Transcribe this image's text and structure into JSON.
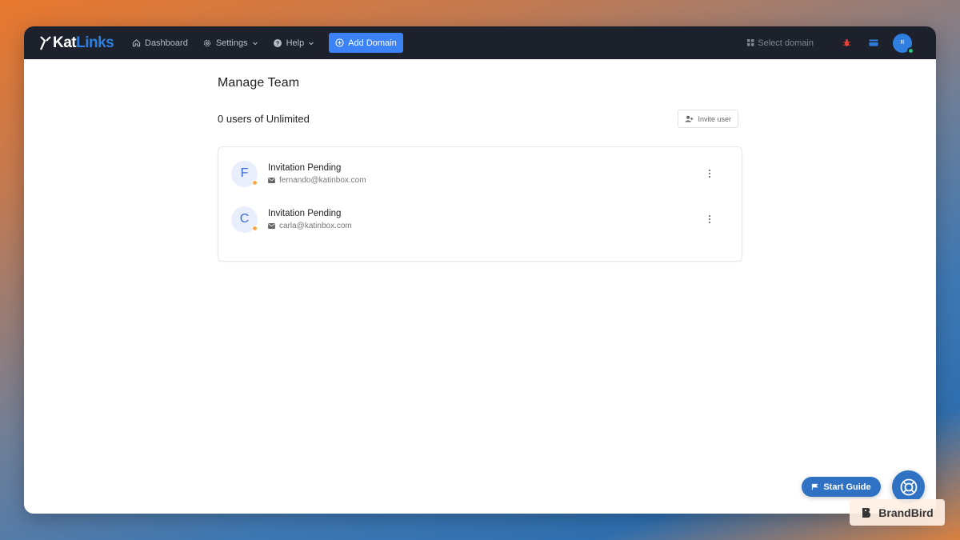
{
  "app": {
    "logo_primary": "Kat",
    "logo_secondary": "Links",
    "accent_color": "#3b82f6"
  },
  "nav": {
    "dashboard": "Dashboard",
    "settings": "Settings",
    "help": "Help",
    "add_domain": "Add Domain"
  },
  "topbar": {
    "select_domain": "Select domain",
    "avatar_initial": "R"
  },
  "page": {
    "title": "Manage Team",
    "users_count": "0 users of Unlimited",
    "invite_button": "Invite user"
  },
  "members": [
    {
      "initial": "F",
      "status": "Invitation Pending",
      "email": "fernando@katinbox.com"
    },
    {
      "initial": "C",
      "status": "Invitation Pending",
      "email": "carla@katinbox.com"
    }
  ],
  "widgets": {
    "start_guide": "Start Guide",
    "watermark": "BrandBird"
  }
}
